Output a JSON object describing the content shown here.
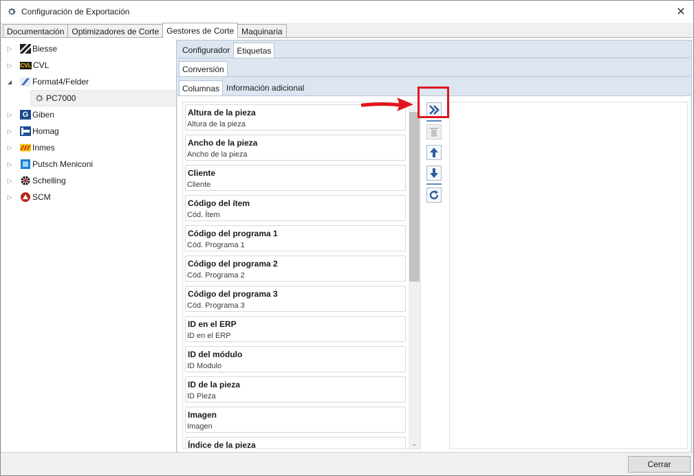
{
  "window": {
    "title": "Configuración de Exportación",
    "close_glyph": "✕"
  },
  "main_tabs": [
    {
      "label": "Documentación"
    },
    {
      "label": "Optimizadores de Corte"
    },
    {
      "label": "Gestores de Corte",
      "active": true
    },
    {
      "label": "Maquinaria"
    }
  ],
  "tree": [
    {
      "label": "Biesse",
      "icon": "biesse-logo-icon",
      "expander": "▷"
    },
    {
      "label": "CVL",
      "icon": "cvl-logo-icon",
      "icon_text": "CVL",
      "expander": "▷"
    },
    {
      "label": "Format4/Felder",
      "icon": "format4-logo-icon",
      "expander": "◢",
      "expanded": true
    },
    {
      "label": "PC7000",
      "icon": "gear-icon",
      "child": true,
      "selected": true
    },
    {
      "label": "Giben",
      "icon": "giben-logo-icon",
      "icon_text": "G",
      "expander": "▷"
    },
    {
      "label": "Homag",
      "icon": "homag-logo-icon",
      "expander": "▷"
    },
    {
      "label": "Inmes",
      "icon": "inmes-logo-icon",
      "expander": "▷"
    },
    {
      "label": "Putsch Meniconi",
      "icon": "putsch-logo-icon",
      "expander": "▷"
    },
    {
      "label": "Schelling",
      "icon": "schelling-logo-icon",
      "expander": "▷"
    },
    {
      "label": "SCM",
      "icon": "scm-logo-icon",
      "expander": "▷"
    }
  ],
  "sub_tabs": [
    {
      "label": "Configurador"
    },
    {
      "label": "Etiquetas",
      "active": true
    }
  ],
  "conversion_tab": {
    "label": "Conversión"
  },
  "column_tabs": [
    {
      "label": "Columnas",
      "active": true
    },
    {
      "label": "Información adicional"
    }
  ],
  "columns": [
    {
      "title": "Altura de la pieza",
      "subtitle": "Altura de la pieza"
    },
    {
      "title": "Ancho de la pieza",
      "subtitle": "Ancho de la pieza"
    },
    {
      "title": "Cliente",
      "subtitle": "Cliente"
    },
    {
      "title": "Código del ítem",
      "subtitle": "Cód. Ítem"
    },
    {
      "title": "Código del programa 1",
      "subtitle": "Cód. Programa 1"
    },
    {
      "title": "Código del programa 2",
      "subtitle": "Cód. Programa 2"
    },
    {
      "title": "Código del programa 3",
      "subtitle": "Cód. Programa 3"
    },
    {
      "title": "ID en el ERP",
      "subtitle": "ID en el ERP"
    },
    {
      "title": "ID del módulo",
      "subtitle": "ID Modulo"
    },
    {
      "title": "ID de la pieza",
      "subtitle": "ID Pieza"
    },
    {
      "title": "Imagen",
      "subtitle": "Imagen"
    },
    {
      "title": "Índice de la pieza",
      "subtitle": ""
    }
  ],
  "side_buttons": {
    "add": "add-all-icon",
    "delete": "trash-icon",
    "up": "arrow-up-icon",
    "down": "arrow-down-icon",
    "reset": "refresh-icon"
  },
  "colors": {
    "accent": "#2e5d9a",
    "highlight": "#e0141e",
    "panel": "#dde6f0"
  },
  "footer": {
    "close_label": "Cerrar"
  }
}
